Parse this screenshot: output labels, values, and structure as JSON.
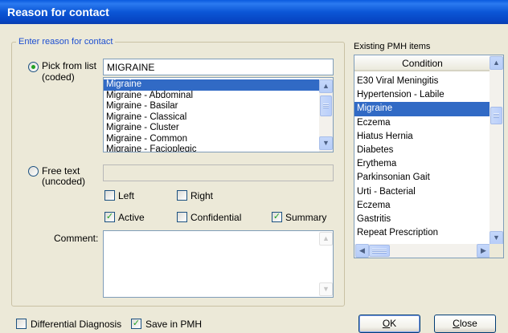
{
  "window": {
    "title": "Reason for contact"
  },
  "group": {
    "legend": "Enter reason for contact"
  },
  "coded": {
    "radio_label_line1": "Pick from list",
    "radio_label_line2": "(coded)",
    "selected": true,
    "search_value": "MIGRAINE",
    "options": [
      "Migraine",
      "Migraine - Abdominal",
      "Migraine - Basilar",
      "Migraine - Classical",
      "Migraine - Cluster",
      "Migraine - Common",
      "Migraine - Facioplegic"
    ],
    "selected_option": "Migraine"
  },
  "freetext": {
    "radio_label_line1": "Free text",
    "radio_label_line2": "(uncoded)",
    "selected": false,
    "value": ""
  },
  "checkboxes": {
    "left": {
      "label": "Left",
      "checked": false
    },
    "right": {
      "label": "Right",
      "checked": false
    },
    "active": {
      "label": "Active",
      "checked": true
    },
    "confidential": {
      "label": "Confidential",
      "checked": false
    },
    "summary": {
      "label": "Summary",
      "checked": true
    }
  },
  "comment": {
    "label": "Comment:",
    "value": ""
  },
  "pmh": {
    "caption": "Existing PMH items",
    "column_header": "Condition",
    "items": [
      "E30 Viral Meningitis",
      "Hypertension - Labile",
      "Migraine",
      "Eczema",
      "Hiatus Hernia",
      "Diabetes",
      "Erythema",
      "Parkinsonian Gait",
      "Urti - Bacterial",
      "Eczema",
      "Gastritis",
      "Repeat Prescription"
    ],
    "selected_item": "Migraine"
  },
  "footer": {
    "differential": {
      "label": "Differential Diagnosis",
      "checked": false
    },
    "save_in_pmh": {
      "label": "Save in PMH",
      "checked": true
    },
    "ok_mnemonic": "O",
    "ok_rest": "K",
    "close_mnemonic": "C",
    "close_rest": "lose"
  },
  "icons": {
    "radio_dot": "radio-dot-icon",
    "check_mark": "✓",
    "scroll_up": "▲",
    "scroll_down": "▼",
    "scroll_left": "◀",
    "scroll_right": "▶"
  },
  "colors": {
    "title_bar": "#0a56d8",
    "selection": "#316ac5",
    "legend_text": "#1c4ed1",
    "check_green": "#21a121",
    "dialog_bg": "#ece9d8"
  }
}
